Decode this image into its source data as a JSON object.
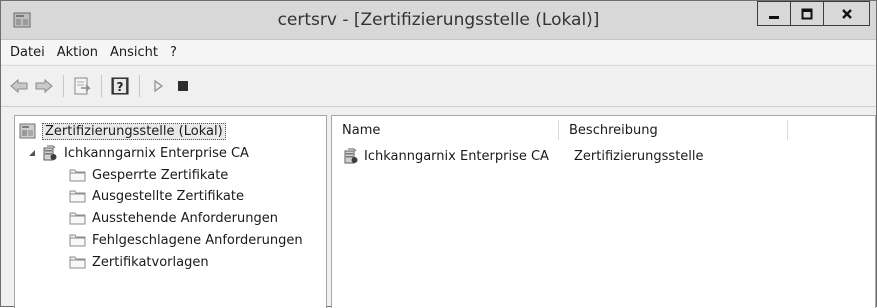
{
  "window": {
    "title": "certsrv - [Zertifizierungsstelle (Lokal)]",
    "app_icon": "console-icon"
  },
  "menubar": {
    "items": [
      "Datei",
      "Aktion",
      "Ansicht",
      "?"
    ]
  },
  "toolbar": {
    "buttons": [
      "back-arrow-icon",
      "forward-arrow-icon",
      "export-list-icon",
      "help-icon",
      "start-service-icon",
      "stop-service-icon"
    ]
  },
  "tree": {
    "root": "Zertifizierungsstelle (Lokal)",
    "ca": {
      "label": "Ichkanngarnix Enterprise CA",
      "children": [
        "Gesperrte Zertifikate",
        "Ausgestellte Zertifikate",
        "Ausstehende Anforderungen",
        "Fehlgeschlagene Anforderungen",
        "Zertifikatvorlagen"
      ]
    }
  },
  "list": {
    "columns": [
      "Name",
      "Beschreibung"
    ],
    "rows": [
      {
        "name": "Ichkanngarnix Enterprise CA",
        "description": "Zertifizierungsstelle"
      }
    ]
  }
}
